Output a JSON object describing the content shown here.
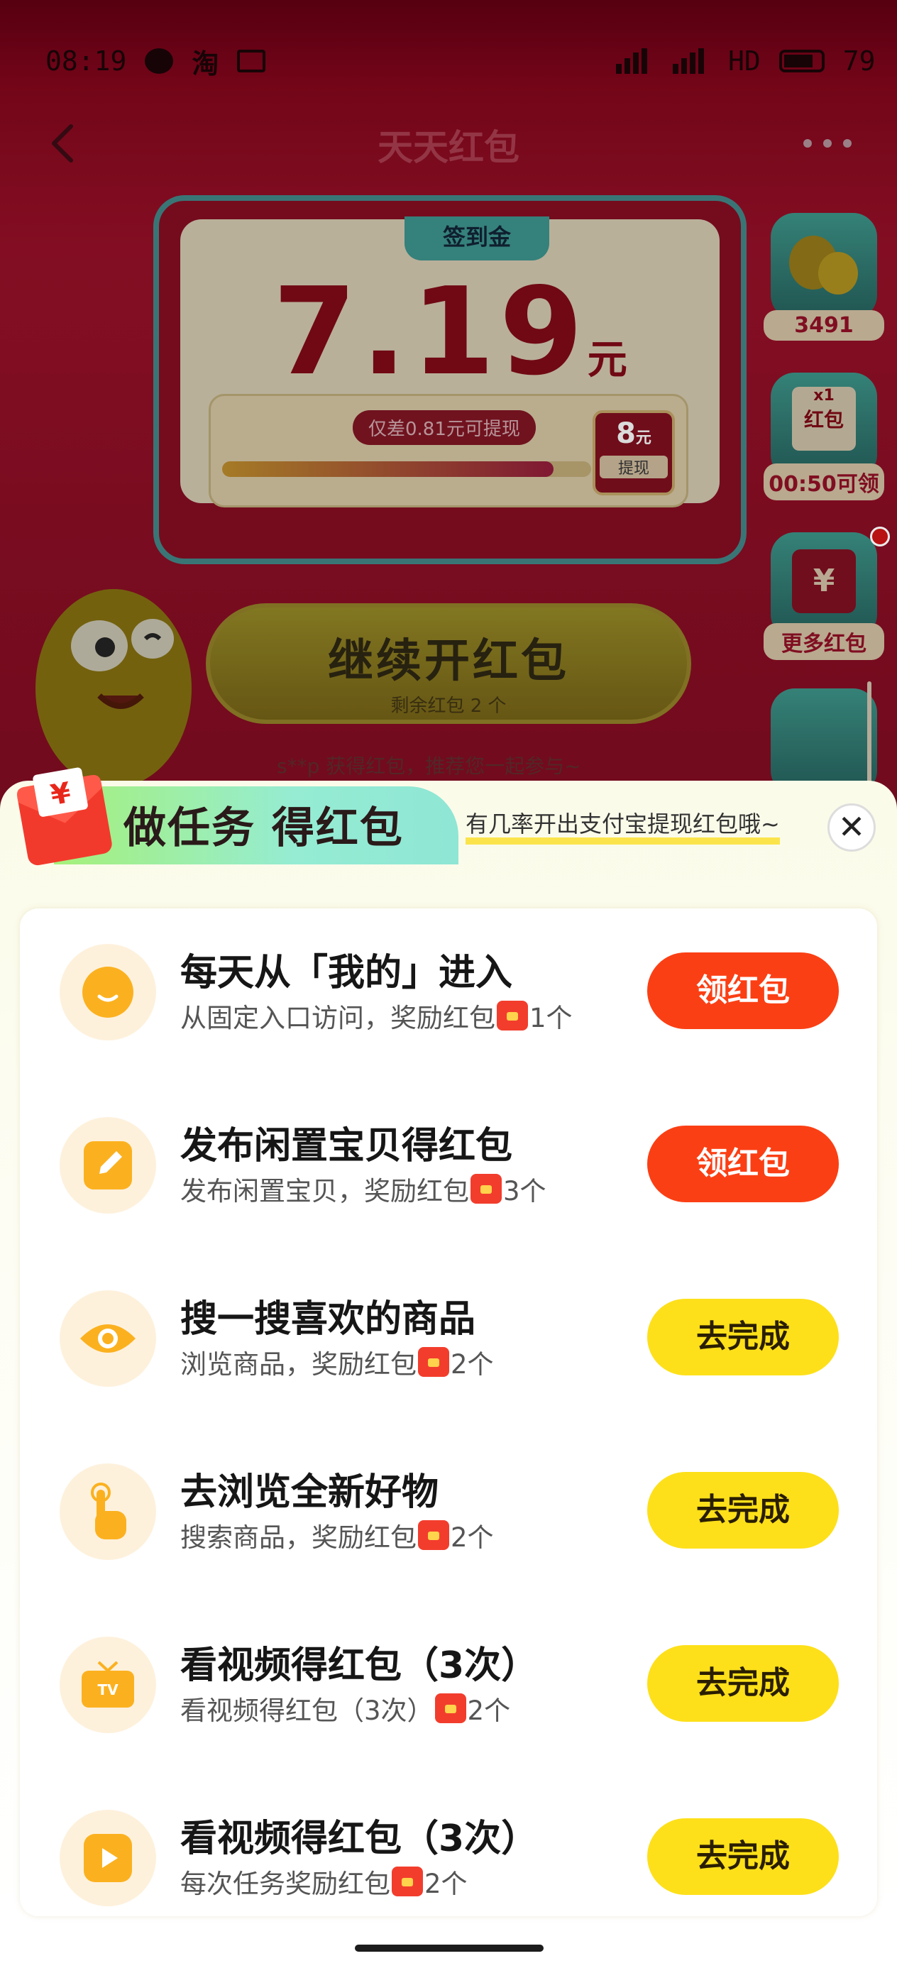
{
  "status_bar": {
    "time": "08:19",
    "network": "HD",
    "battery": "79"
  },
  "header": {
    "title": "天天红包"
  },
  "sign_card": {
    "tab_label": "签到金",
    "amount": "7.19",
    "unit": "元",
    "hint": "仅差0.81元可提现",
    "progress_fraction": 0.899,
    "goal_amount": "8",
    "goal_unit": "元",
    "goal_label": "提现"
  },
  "main_button": {
    "label": "继续开红包",
    "sub": "剩余红包 2 个"
  },
  "ticker": "s**p 获得红包，推荐您一起参与~",
  "side_widgets": [
    {
      "label": "3491",
      "icon": "coins-icon"
    },
    {
      "badge": "x1",
      "name": "红包",
      "label": "00:50可领",
      "icon": "red-envelope-icon"
    },
    {
      "label": "更多红包",
      "icon": "yuan-envelope-icon"
    }
  ],
  "task_panel": {
    "title": "做任务 得红包",
    "subtitle": "有几率开出支付宝提现红包哦~",
    "close_symbol": "✕",
    "tasks": [
      {
        "title": "每天从「我的」进入",
        "desc": "从固定入口访问，奖励红包",
        "count": "1个",
        "button": "领红包",
        "style": "red",
        "icon": "smile-icon"
      },
      {
        "title": "发布闲置宝贝得红包",
        "desc": "发布闲置宝贝，奖励红包",
        "count": "3个",
        "button": "领红包",
        "style": "red",
        "icon": "edit-icon"
      },
      {
        "title": "搜一搜喜欢的商品",
        "desc": "浏览商品，奖励红包",
        "count": "2个",
        "button": "去完成",
        "style": "yellow",
        "icon": "eye-icon"
      },
      {
        "title": "去浏览全新好物",
        "desc": "搜索商品，奖励红包",
        "count": "2个",
        "button": "去完成",
        "style": "yellow",
        "icon": "pointer-hand-icon"
      },
      {
        "title": "看视频得红包（3次）",
        "desc": "看视频得红包（3次）",
        "count": "2个",
        "button": "去完成",
        "style": "yellow",
        "icon": "tv-icon"
      },
      {
        "title": "看视频得红包（3次）",
        "desc": "每次任务奖励红包",
        "count": "2个",
        "button": "去完成",
        "style": "yellow",
        "icon": "video-play-icon"
      }
    ]
  },
  "colors": {
    "accent_red": "#fb3f14",
    "accent_yellow": "#fde01a",
    "background_red": "#8f1026"
  }
}
